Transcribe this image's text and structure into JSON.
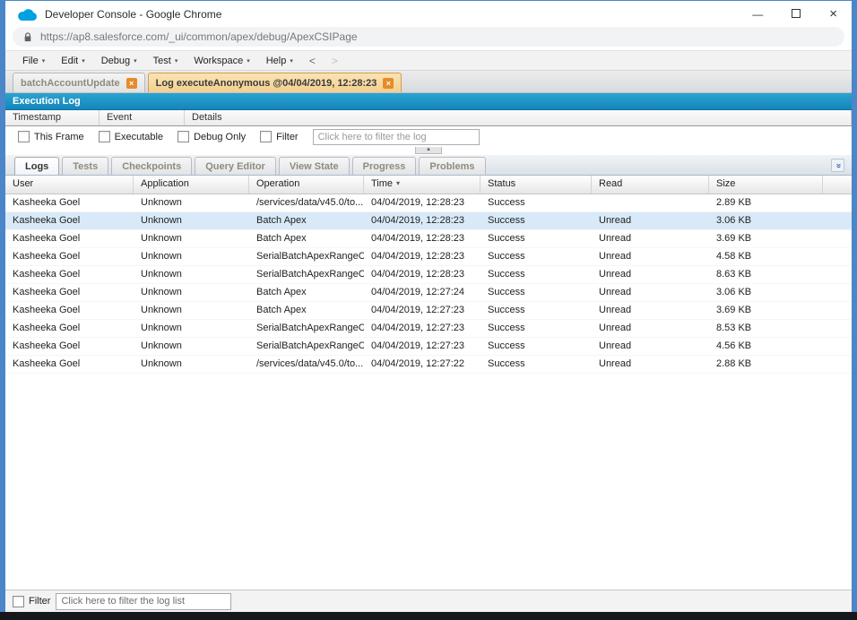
{
  "colors": {
    "frame_blue": "#4a86c8",
    "panel_header_blue": "#1b95c7",
    "active_tab_orange": "#f3cf8f",
    "selected_row_blue": "#d8eaf8",
    "salesforce_blue": "#00a1e0",
    "close_x_orange": "#e78b2a"
  },
  "window": {
    "title": "Developer Console - Google Chrome",
    "controls": {
      "minimize": "—",
      "maximize": "□",
      "close": "×"
    }
  },
  "urlbar": {
    "url": "https://ap8.salesforce.com/_ui/common/apex/debug/ApexCSIPage"
  },
  "menubar": {
    "items": [
      "File",
      "Edit",
      "Debug",
      "Test",
      "Workspace",
      "Help"
    ],
    "back": "<",
    "forward": ">"
  },
  "workspace_tabs": [
    {
      "label": "batchAccountUpdate",
      "active": false
    },
    {
      "label": "Log executeAnonymous @04/04/2019, 12:28:23",
      "active": true
    }
  ],
  "execution_log": {
    "title": "Execution Log",
    "columns": [
      "Timestamp",
      "Event",
      "Details"
    ],
    "filters": [
      "This Frame",
      "Executable",
      "Debug Only",
      "Filter"
    ],
    "filter_placeholder": "Click here to filter the log"
  },
  "panel_tabs": [
    {
      "label": "Logs",
      "active": true
    },
    {
      "label": "Tests",
      "active": false
    },
    {
      "label": "Checkpoints",
      "active": false
    },
    {
      "label": "Query Editor",
      "active": false
    },
    {
      "label": "View State",
      "active": false
    },
    {
      "label": "Progress",
      "active": false
    },
    {
      "label": "Problems",
      "active": false
    }
  ],
  "log_table": {
    "columns": [
      {
        "label": "User"
      },
      {
        "label": "Application"
      },
      {
        "label": "Operation"
      },
      {
        "label": "Time",
        "sort": "desc"
      },
      {
        "label": "Status"
      },
      {
        "label": "Read"
      },
      {
        "label": "Size"
      }
    ],
    "selected_row_index": 1,
    "rows": [
      [
        "Kasheeka Goel",
        "Unknown",
        "/services/data/v45.0/to...",
        "04/04/2019, 12:28:23",
        "Success",
        "",
        "2.89 KB"
      ],
      [
        "Kasheeka Goel",
        "Unknown",
        "Batch Apex",
        "04/04/2019, 12:28:23",
        "Success",
        "Unread",
        "3.06 KB"
      ],
      [
        "Kasheeka Goel",
        "Unknown",
        "Batch Apex",
        "04/04/2019, 12:28:23",
        "Success",
        "Unread",
        "3.69 KB"
      ],
      [
        "Kasheeka Goel",
        "Unknown",
        "SerialBatchApexRangeC...",
        "04/04/2019, 12:28:23",
        "Success",
        "Unread",
        "4.58 KB"
      ],
      [
        "Kasheeka Goel",
        "Unknown",
        "SerialBatchApexRangeC...",
        "04/04/2019, 12:28:23",
        "Success",
        "Unread",
        "8.63 KB"
      ],
      [
        "Kasheeka Goel",
        "Unknown",
        "Batch Apex",
        "04/04/2019, 12:27:24",
        "Success",
        "Unread",
        "3.06 KB"
      ],
      [
        "Kasheeka Goel",
        "Unknown",
        "Batch Apex",
        "04/04/2019, 12:27:23",
        "Success",
        "Unread",
        "3.69 KB"
      ],
      [
        "Kasheeka Goel",
        "Unknown",
        "SerialBatchApexRangeC...",
        "04/04/2019, 12:27:23",
        "Success",
        "Unread",
        "8.53 KB"
      ],
      [
        "Kasheeka Goel",
        "Unknown",
        "SerialBatchApexRangeC...",
        "04/04/2019, 12:27:23",
        "Success",
        "Unread",
        "4.56 KB"
      ],
      [
        "Kasheeka Goel",
        "Unknown",
        "/services/data/v45.0/to...",
        "04/04/2019, 12:27:22",
        "Success",
        "Unread",
        "2.88 KB"
      ]
    ]
  },
  "bottom_filter": {
    "label": "Filter",
    "placeholder": "Click here to filter the log list"
  }
}
